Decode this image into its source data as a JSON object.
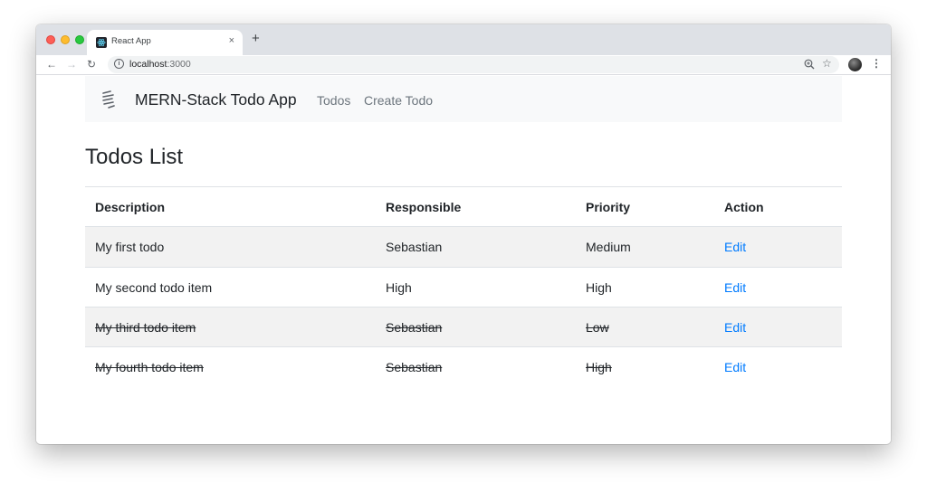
{
  "browser": {
    "tab_title": "React App",
    "tab_close": "×",
    "new_tab": "+",
    "url_host": "localhost",
    "url_port": ":3000"
  },
  "navbar": {
    "brand": "MERN-Stack Todo App",
    "links": [
      "Todos",
      "Create Todo"
    ]
  },
  "page": {
    "title": "Todos List"
  },
  "table": {
    "headers": [
      "Description",
      "Responsible",
      "Priority",
      "Action"
    ],
    "rows": [
      {
        "description": "My first todo",
        "responsible": "Sebastian",
        "priority": "Medium",
        "action": "Edit",
        "completed": false
      },
      {
        "description": "My second todo item",
        "responsible": "High",
        "priority": "High",
        "action": "Edit",
        "completed": false
      },
      {
        "description": "My third todo item",
        "responsible": "Sebastian",
        "priority": "Low",
        "action": "Edit",
        "completed": true
      },
      {
        "description": "My fourth todo item",
        "responsible": "Sebastian",
        "priority": "High",
        "action": "Edit",
        "completed": true
      }
    ]
  },
  "colors": {
    "link": "#007bff",
    "navbar_bg": "#f8f9fa",
    "stripe_bg": "#f2f2f2",
    "tabstrip_bg": "#dee1e6"
  },
  "icons": {
    "favicon": "react-logo-icon",
    "navbar_logo": "stack-logo-icon",
    "back": "arrow-left-icon",
    "forward": "arrow-right-icon",
    "reload": "reload-icon",
    "info": "info-icon",
    "zoom": "zoom-icon",
    "bookmark": "star-icon",
    "menu": "kebab-menu-icon"
  }
}
